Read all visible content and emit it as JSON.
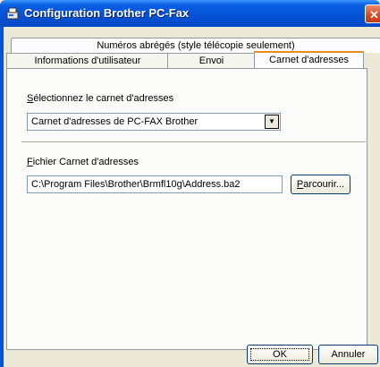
{
  "window": {
    "title": "Configuration Brother PC-Fax",
    "icon": "fax-app-icon",
    "close_glyph": "✕"
  },
  "tabs": {
    "row_top": [
      "Numéros abrégés (style télécopie seulement)"
    ],
    "row_bottom": [
      "Informations d'utilisateur",
      "Envoi",
      "Carnet d'adresses"
    ],
    "selected": "Carnet d'adresses"
  },
  "address_book": {
    "select_label_mnemonic": "S",
    "select_label_rest": "électionnez le carnet d'adresses",
    "selected_value": "Carnet d'adresses de PC-FAX Brother",
    "dropdown_glyph": "▼",
    "file_label_mnemonic": "F",
    "file_label_rest": "ichier Carnet d'adresses",
    "file_path": "C:\\Program Files\\Brother\\Brmfl10g\\Address.ba2",
    "browse_mnemonic": "P",
    "browse_rest": "arcourir..."
  },
  "buttons": {
    "ok": "OK",
    "cancel": "Annuler"
  }
}
